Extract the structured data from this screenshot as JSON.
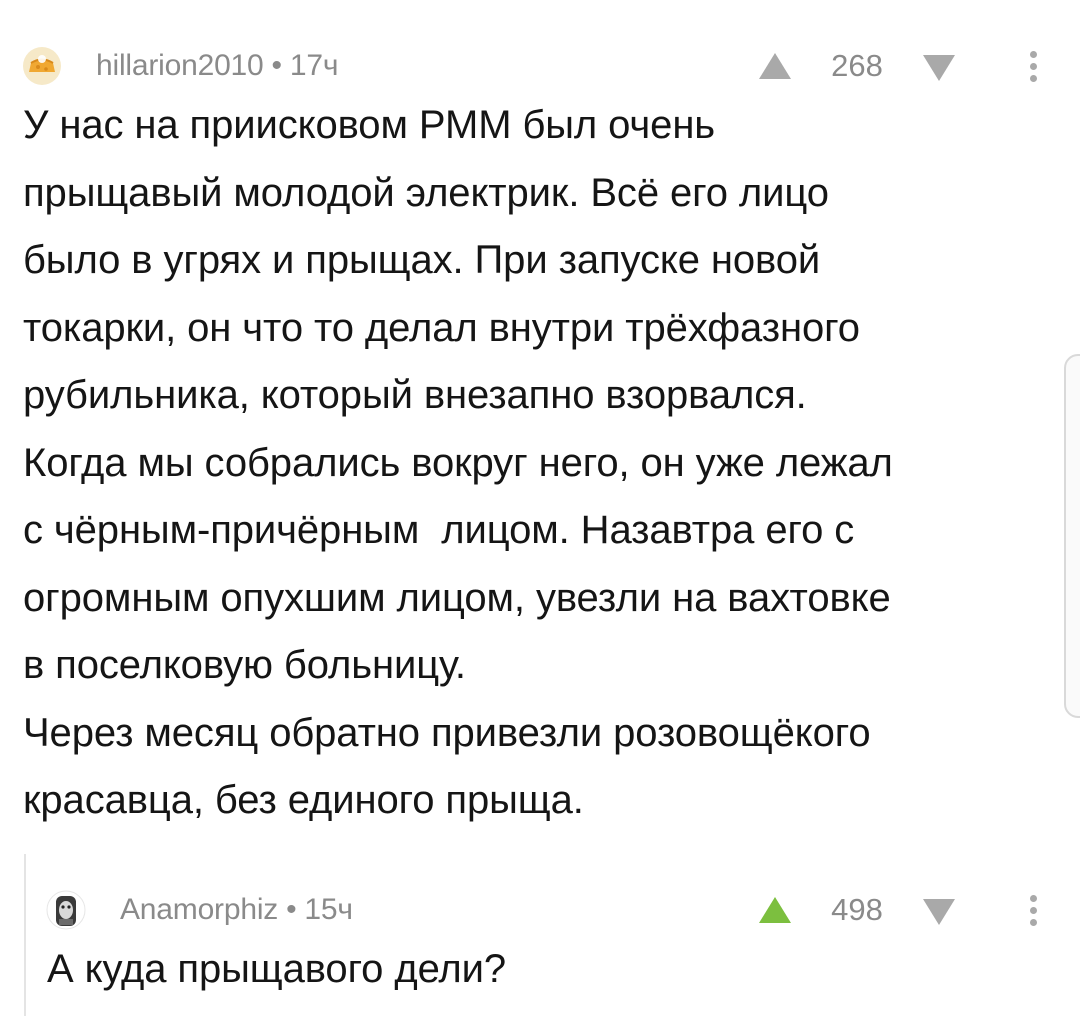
{
  "comments": [
    {
      "avatar": "cheese-bread-avatar",
      "author": "hillarion2010",
      "separator": "•",
      "time": "17ч",
      "rating": "268",
      "upvote_active": false,
      "body": "У нас на приисковом РММ был очень\nпрыщавый молодой электрик. Всё его лицо\nбыло в угрях и прыщах. При запуске новой\nтокарки, он что то делал внутри трёхфазного\nрубильника, который внезапно взорвался.\nКогда мы собрались вокруг него, он уже лежал\nс чёрным-причёрным  лицом. Назавтра его с\nогромным опухшим лицом, увезли на вахтовке\nв поселковую больницу.\nЧерез месяц обратно привезли розовощёкого\nкрасавца, без единого прыща."
    },
    {
      "avatar": "monkey-avatar",
      "author": "Anamorphiz",
      "separator": "•",
      "time": "15ч",
      "rating": "498",
      "upvote_active": true,
      "body": "А куда прыщавого дели?"
    }
  ],
  "colors": {
    "meta_text": "#8a8a8a",
    "vote_inactive": "#a9a9a9",
    "vote_active": "#7cbf3f",
    "body_text": "#151515"
  }
}
